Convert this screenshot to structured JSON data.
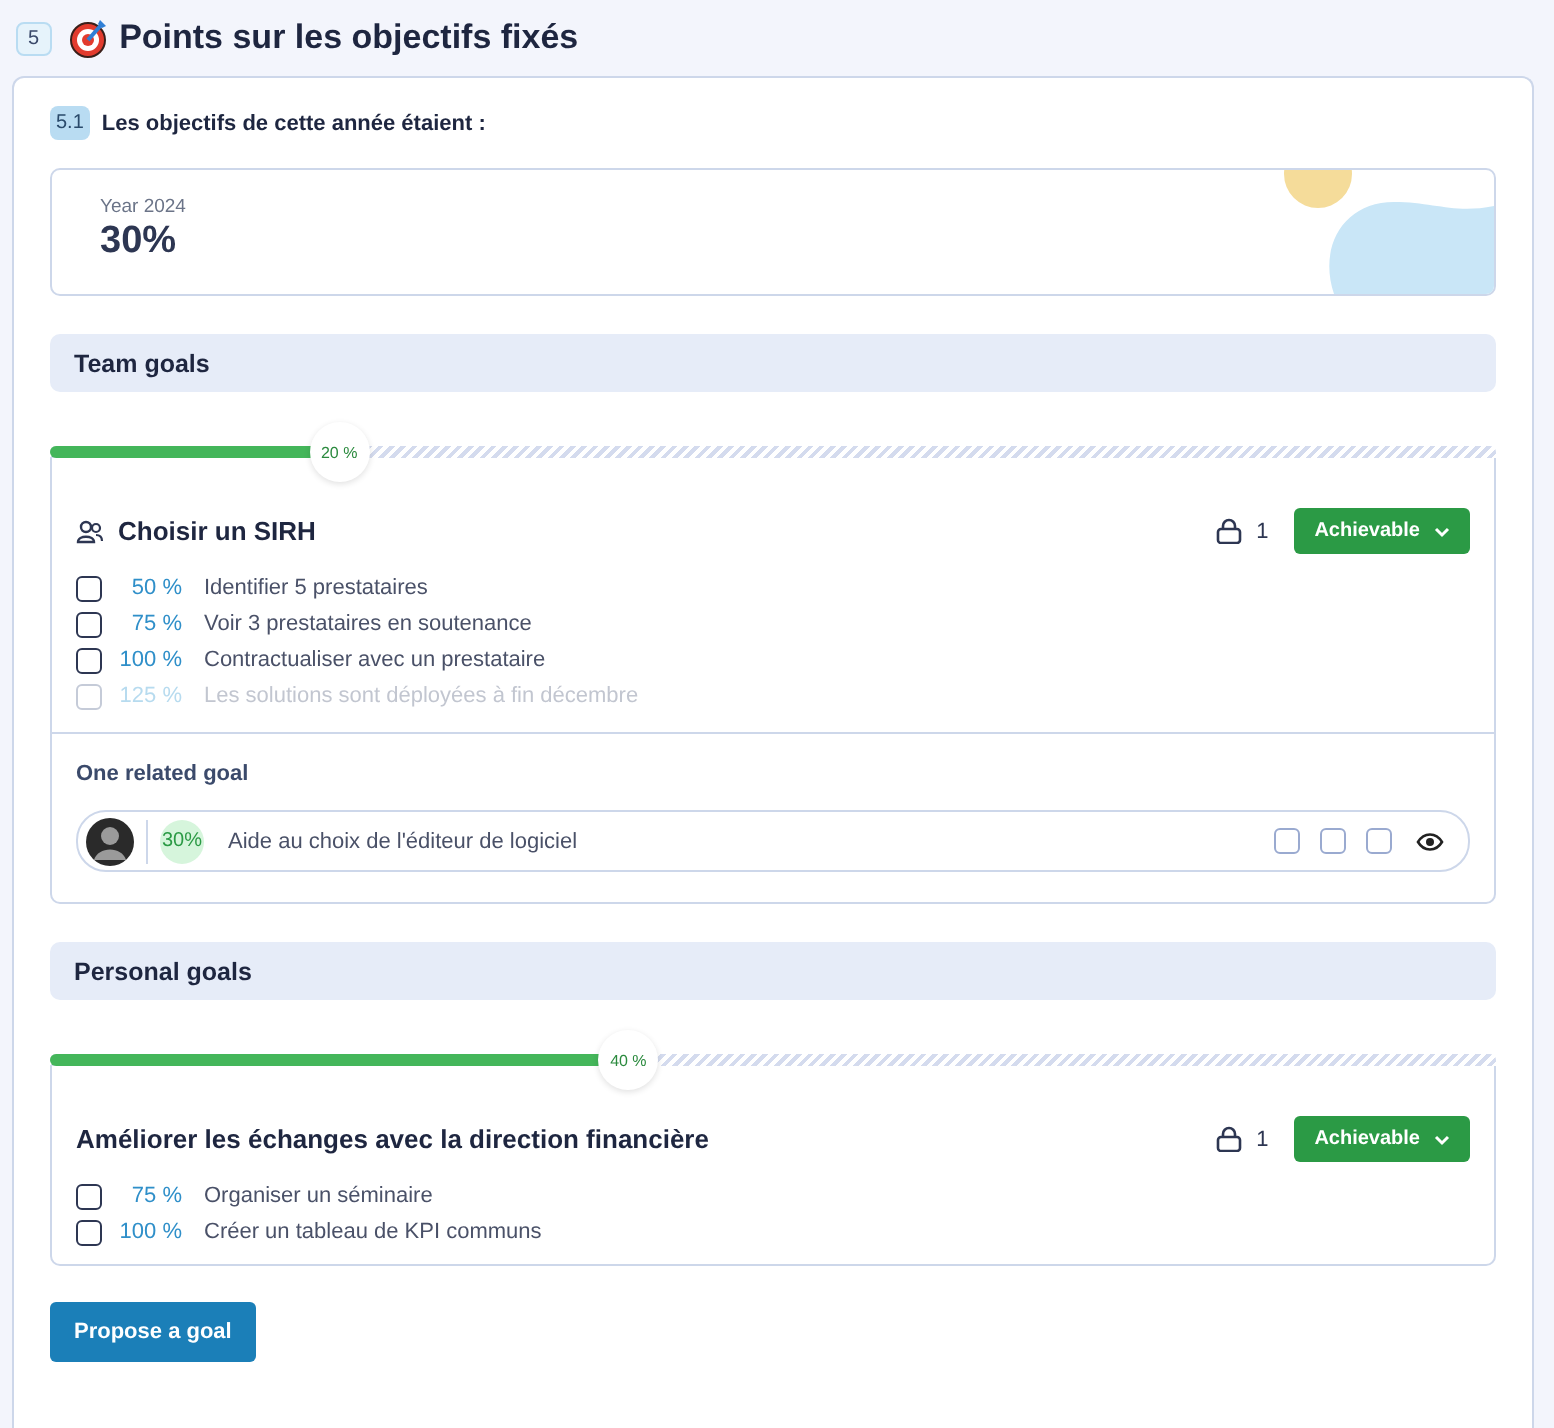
{
  "section": {
    "number": "5",
    "title": "Points sur les objectifs fixés"
  },
  "subsection": {
    "number": "5.1",
    "title": "Les objectifs de cette année étaient :"
  },
  "year_card": {
    "label": "Year 2024",
    "value": "30%"
  },
  "groups": [
    {
      "title": "Team goals",
      "goals": [
        {
          "kind": "team",
          "progress": {
            "level": 0.2,
            "label": "20 %"
          },
          "title": "Choisir un SIRH",
          "lock_count": "1",
          "status": "Achievable",
          "milestones": [
            {
              "percent": "50 %",
              "label": "Identifier 5 prestataires",
              "checked": false,
              "disabled": false
            },
            {
              "percent": "75 %",
              "label": "Voir 3 prestataires en soutenance",
              "checked": false,
              "disabled": false
            },
            {
              "percent": "100 %",
              "label": "Contractualiser avec un prestataire",
              "checked": false,
              "disabled": false
            },
            {
              "percent": "125 %",
              "label": "Les solutions sont déployées à fin décembre",
              "checked": false,
              "disabled": true
            }
          ],
          "related": {
            "heading": "One related goal",
            "items": [
              {
                "percent": "30%",
                "title": "Aide au choix de l'éditeur de logiciel"
              }
            ]
          }
        }
      ]
    },
    {
      "title": "Personal goals",
      "goals": [
        {
          "kind": "personal",
          "progress": {
            "level": 0.4,
            "label": "40 %"
          },
          "title": "Améliorer les échanges avec la direction financière",
          "lock_count": "1",
          "status": "Achievable",
          "milestones": [
            {
              "percent": "75 %",
              "label": "Organiser un séminaire",
              "checked": false,
              "disabled": false
            },
            {
              "percent": "100 %",
              "label": "Créer un tableau de KPI communs",
              "checked": false,
              "disabled": false
            }
          ]
        }
      ]
    }
  ],
  "button": "Propose a goal"
}
